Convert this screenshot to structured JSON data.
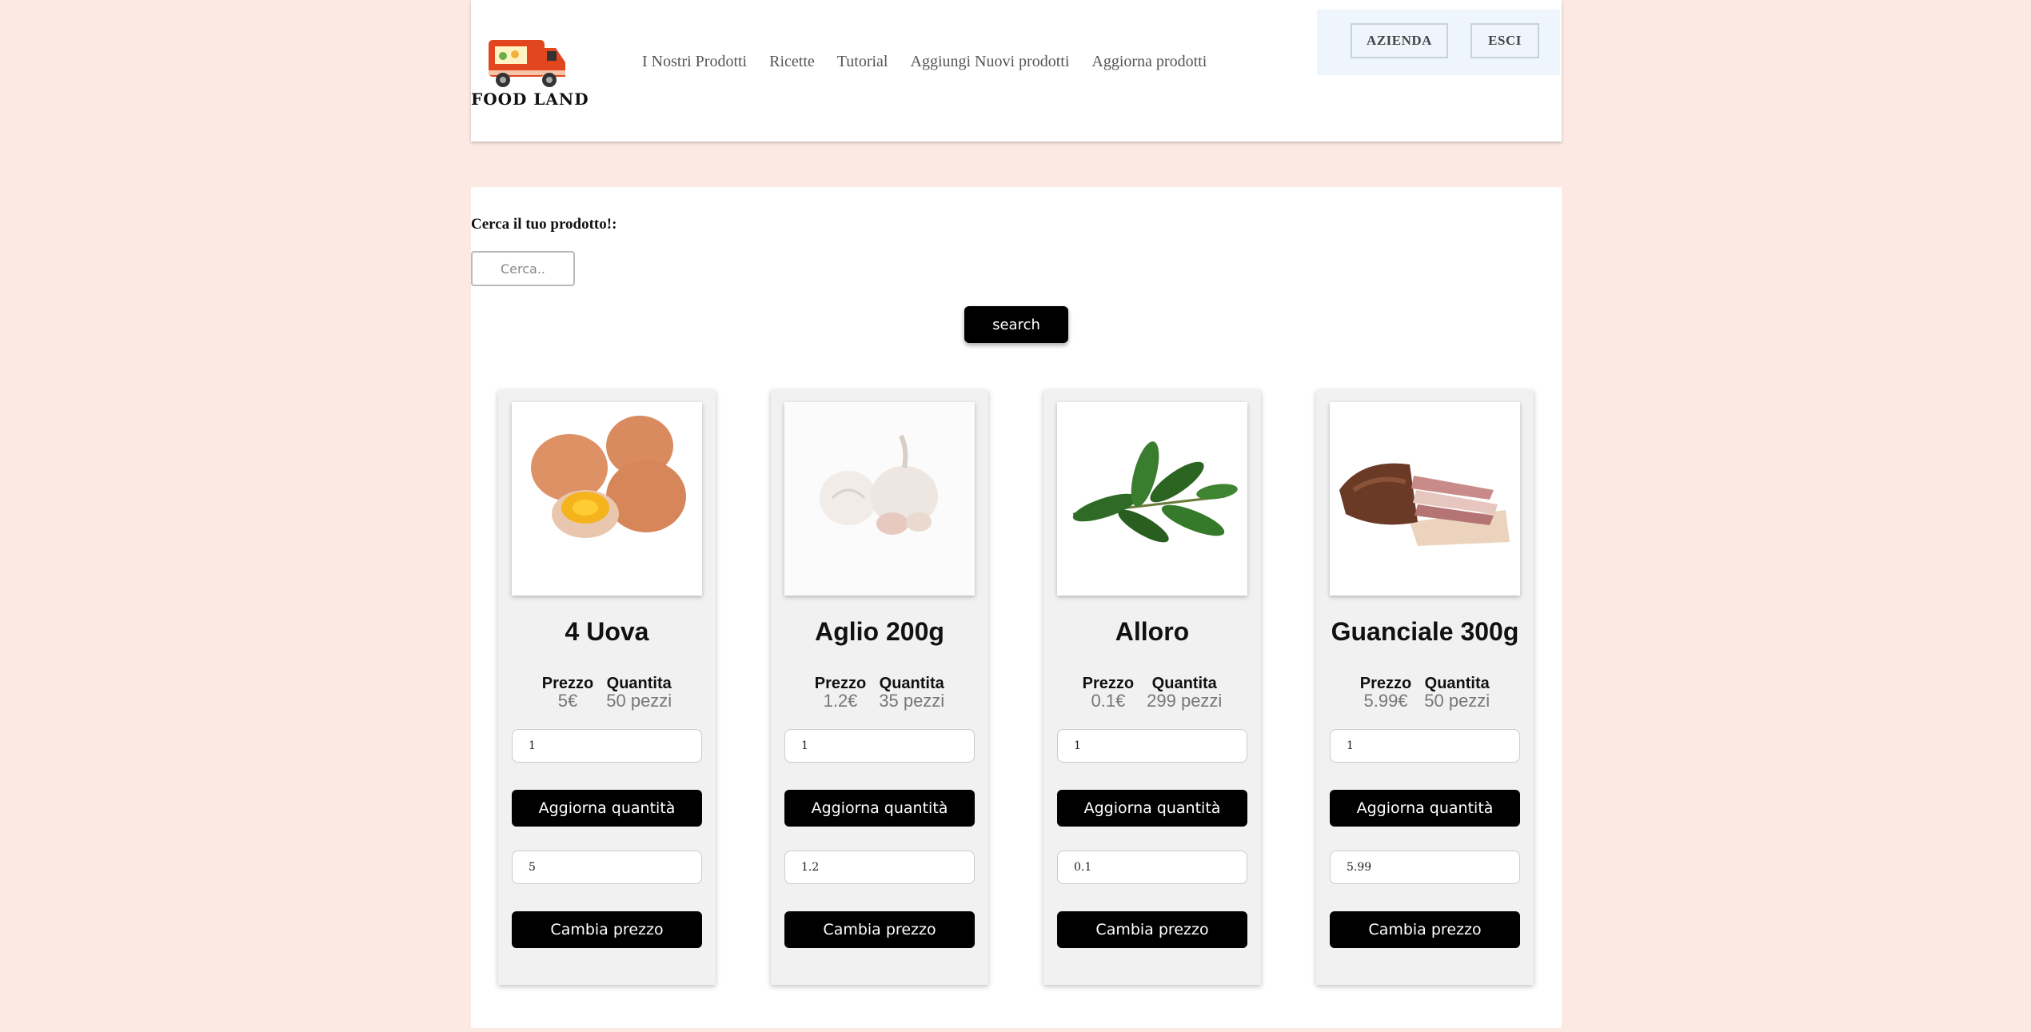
{
  "header": {
    "logo_text": "FOOD LAND",
    "nav": [
      "I Nostri Prodotti",
      "Ricette",
      "Tutorial",
      "Aggiungi Nuovi prodotti",
      "Aggiorna prodotti"
    ],
    "azienda_label": "AZIENDA",
    "esci_label": "ESCI"
  },
  "search": {
    "label": "Cerca il tuo prodotto!:",
    "placeholder": "Cerca..",
    "button_label": "search"
  },
  "labels": {
    "price": "Prezzo",
    "quantity": "Quantita",
    "update_quantity": "Aggiorna quantità",
    "change_price": "Cambia prezzo"
  },
  "products": [
    {
      "name": "4 Uova",
      "price": "5€",
      "quantity": "50 pezzi",
      "qty_input": "1",
      "price_input": "5",
      "image": "eggs-image"
    },
    {
      "name": "Aglio 200g",
      "price": "1.2€",
      "quantity": "35 pezzi",
      "qty_input": "1",
      "price_input": "1.2",
      "image": "garlic-image"
    },
    {
      "name": "Alloro",
      "price": "0.1€",
      "quantity": "299 pezzi",
      "qty_input": "1",
      "price_input": "0.1",
      "image": "bay-leaf-image"
    },
    {
      "name": "Guanciale 300g",
      "price": "5.99€",
      "quantity": "50 pezzi",
      "qty_input": "1",
      "price_input": "5.99",
      "image": "guanciale-image"
    }
  ],
  "colors": {
    "page_bg": "#fde9e3",
    "button_bg": "#000000",
    "card_bg": "#f1f1f1",
    "truck_red": "#e2461f"
  }
}
